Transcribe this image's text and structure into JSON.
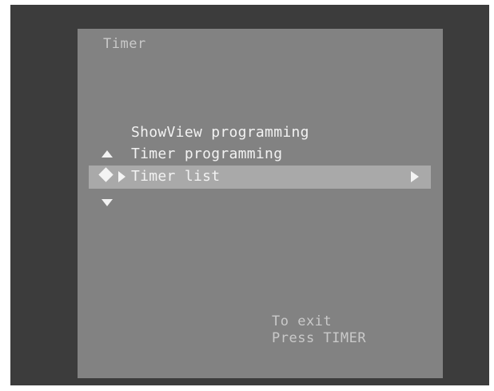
{
  "osd": {
    "title": "Timer",
    "menu": {
      "items": [
        {
          "label": "ShowView programming",
          "selected": false
        },
        {
          "label": "Timer programming",
          "selected": false
        },
        {
          "label": "Timer list",
          "selected": true,
          "has_submenu": true
        }
      ],
      "navigation_icons": [
        "arrow-up-icon",
        "arrow-down-icon",
        "diamond-cursor-icon",
        "play-cursor-icon",
        "submenu-arrow-icon"
      ]
    },
    "hint": {
      "line1": "To exit",
      "line2": "Press TIMER"
    }
  },
  "colors": {
    "screen_background": "#3c3c3c",
    "osd_background": "#828282",
    "highlight_bar": "#a9a9a9",
    "text": "#f2f2f2",
    "dim_text": "#c9c9c9"
  }
}
